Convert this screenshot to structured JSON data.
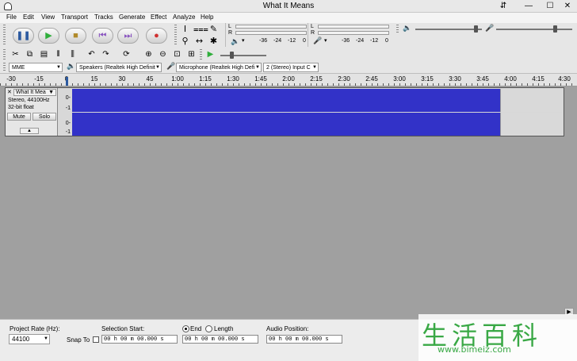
{
  "window": {
    "title": "What It Means"
  },
  "menu": [
    "File",
    "Edit",
    "View",
    "Transport",
    "Tracks",
    "Generate",
    "Effect",
    "Analyze",
    "Help"
  ],
  "transport": {
    "pause_icon": "pause-icon",
    "play_icon": "play-icon",
    "stop_icon": "stop-icon",
    "skip_start_icon": "skip-to-start-icon",
    "skip_end_icon": "skip-to-end-icon",
    "record_icon": "record-icon",
    "accent_play": "#2fae3b",
    "accent_record": "#d03030"
  },
  "meters": {
    "playback": {
      "l": "L",
      "r": "R",
      "ticks": [
        "-36",
        "-24",
        "-12",
        "0"
      ]
    },
    "record": {
      "l": "L",
      "r": "R",
      "ticks": [
        "-36",
        "-24",
        "-12",
        "0"
      ]
    }
  },
  "device": {
    "host": "MME",
    "output": "Speakers (Realtek High Definit",
    "input": "Microphone (Realtek High Defi",
    "channels": "2 (Stereo) Input C"
  },
  "ruler": [
    "-30",
    "-15",
    "0",
    "15",
    "30",
    "45",
    "1:00",
    "1:15",
    "1:30",
    "1:45",
    "2:00",
    "2:15",
    "2:30",
    "2:45",
    "3:00",
    "3:15",
    "3:30",
    "3:45",
    "4:00",
    "4:15",
    "4:30"
  ],
  "track": {
    "name": "What It Mea",
    "info": "Stereo, 44100Hz",
    "format": "32-bit float",
    "mute": "Mute",
    "solo": "Solo",
    "scale_top": "0-",
    "scale_bottom": "-1",
    "waveform_color": "#3232c8",
    "audio_end": "3:50"
  },
  "statusbar": {
    "project_rate_label": "Project Rate (Hz):",
    "project_rate": "44100",
    "snap_to": "Snap To",
    "selection_start_label": "Selection Start:",
    "end_label": "End",
    "length_label": "Length",
    "audio_position_label": "Audio Position:",
    "selection_start": "00 h 00 m 00.000 s",
    "selection_end": "00 h 00 m 00.000 s",
    "audio_position": "00 h 00 m 00.000 s"
  },
  "watermark": {
    "chars": "生活百科",
    "url": "www.bimeiz.com"
  }
}
